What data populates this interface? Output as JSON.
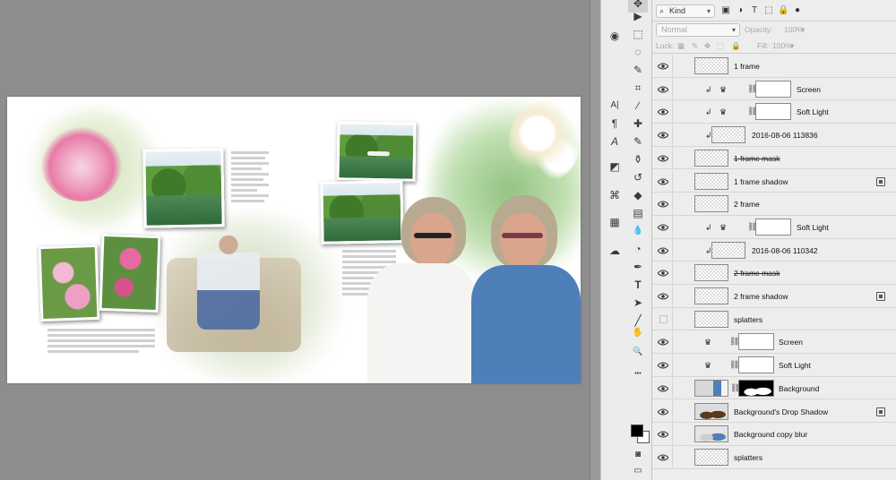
{
  "canvas": {
    "background": "#8d8d8d"
  },
  "tools": [
    {
      "name": "move-tool",
      "glyph": "✥"
    },
    {
      "name": "artboard-tool",
      "glyph": "▶"
    },
    {
      "name": "marquee-tool",
      "glyph": "⬚"
    },
    {
      "name": "lasso-tool",
      "glyph": "◌"
    },
    {
      "name": "quick-select-tool",
      "glyph": "✎"
    },
    {
      "name": "crop-tool",
      "glyph": "⌗"
    },
    {
      "name": "eyedropper-tool",
      "glyph": "⁄"
    },
    {
      "name": "healing-tool",
      "glyph": "✚"
    },
    {
      "name": "brush-tool",
      "glyph": "✎"
    },
    {
      "name": "clone-stamp-tool",
      "glyph": "⚱"
    },
    {
      "name": "history-brush-tool",
      "glyph": "↺"
    },
    {
      "name": "eraser-tool",
      "glyph": "◆"
    },
    {
      "name": "gradient-tool",
      "glyph": "▤"
    },
    {
      "name": "blur-tool",
      "glyph": "💧"
    },
    {
      "name": "dodge-tool",
      "glyph": "◔"
    },
    {
      "name": "pen-tool",
      "glyph": "✒"
    },
    {
      "name": "type-tool",
      "glyph": "T"
    },
    {
      "name": "path-select-tool",
      "glyph": "➤"
    },
    {
      "name": "line-tool",
      "glyph": "╱"
    },
    {
      "name": "hand-tool",
      "glyph": "✋"
    },
    {
      "name": "zoom-tool",
      "glyph": "🔍"
    },
    {
      "name": "more-tools",
      "glyph": "•••"
    },
    {
      "name": "quick-mask",
      "glyph": "◙"
    },
    {
      "name": "screen-mode",
      "glyph": "▭"
    }
  ],
  "side_tools": [
    {
      "name": "character-panel",
      "glyph": "A|"
    },
    {
      "name": "paragraph-panel",
      "glyph": "¶"
    },
    {
      "name": "glyphs-panel",
      "glyph": "A"
    },
    {
      "name": "libraries-panel",
      "glyph": "◩"
    },
    {
      "name": "paths-panel",
      "glyph": "⌘"
    },
    {
      "name": "swatches-panel",
      "glyph": "▦"
    },
    {
      "name": "creative-cloud-panel",
      "glyph": "☁"
    }
  ],
  "colors": {
    "foreground": "#000000",
    "background": "#ffffff",
    "panel_bg": "#ededed",
    "accent": "#d0d0d0"
  },
  "layers_panel": {
    "filter_kind": "Kind",
    "blend_mode": "Normal",
    "opacity_label": "Opacity:",
    "opacity_value": "100%",
    "lock_label": "Lock:",
    "fill_label": "Fill:",
    "fill_value": "100%"
  },
  "layers": [
    {
      "name": "1 frame",
      "visible": true
    },
    {
      "name": "Screen",
      "visible": true
    },
    {
      "name": "Soft Light",
      "visible": true
    },
    {
      "name": "2016-08-06 113836",
      "visible": true
    },
    {
      "name": "1 frame mask",
      "visible": true
    },
    {
      "name": "1 frame shadow",
      "visible": true
    },
    {
      "name": "2 frame",
      "visible": true
    },
    {
      "name": "Soft Light",
      "visible": true
    },
    {
      "name": "2016-08-06 110342",
      "visible": true
    },
    {
      "name": "2 frame mask",
      "visible": true
    },
    {
      "name": "2 frame shadow",
      "visible": true
    },
    {
      "name": "splatters",
      "visible": false
    },
    {
      "name": "Screen",
      "visible": true
    },
    {
      "name": "Soft Light",
      "visible": true
    },
    {
      "name": "Background",
      "visible": true
    },
    {
      "name": "Background's Drop Shadow",
      "visible": true
    },
    {
      "name": "Background copy blur",
      "visible": true
    },
    {
      "name": "splatters",
      "visible": true
    }
  ]
}
